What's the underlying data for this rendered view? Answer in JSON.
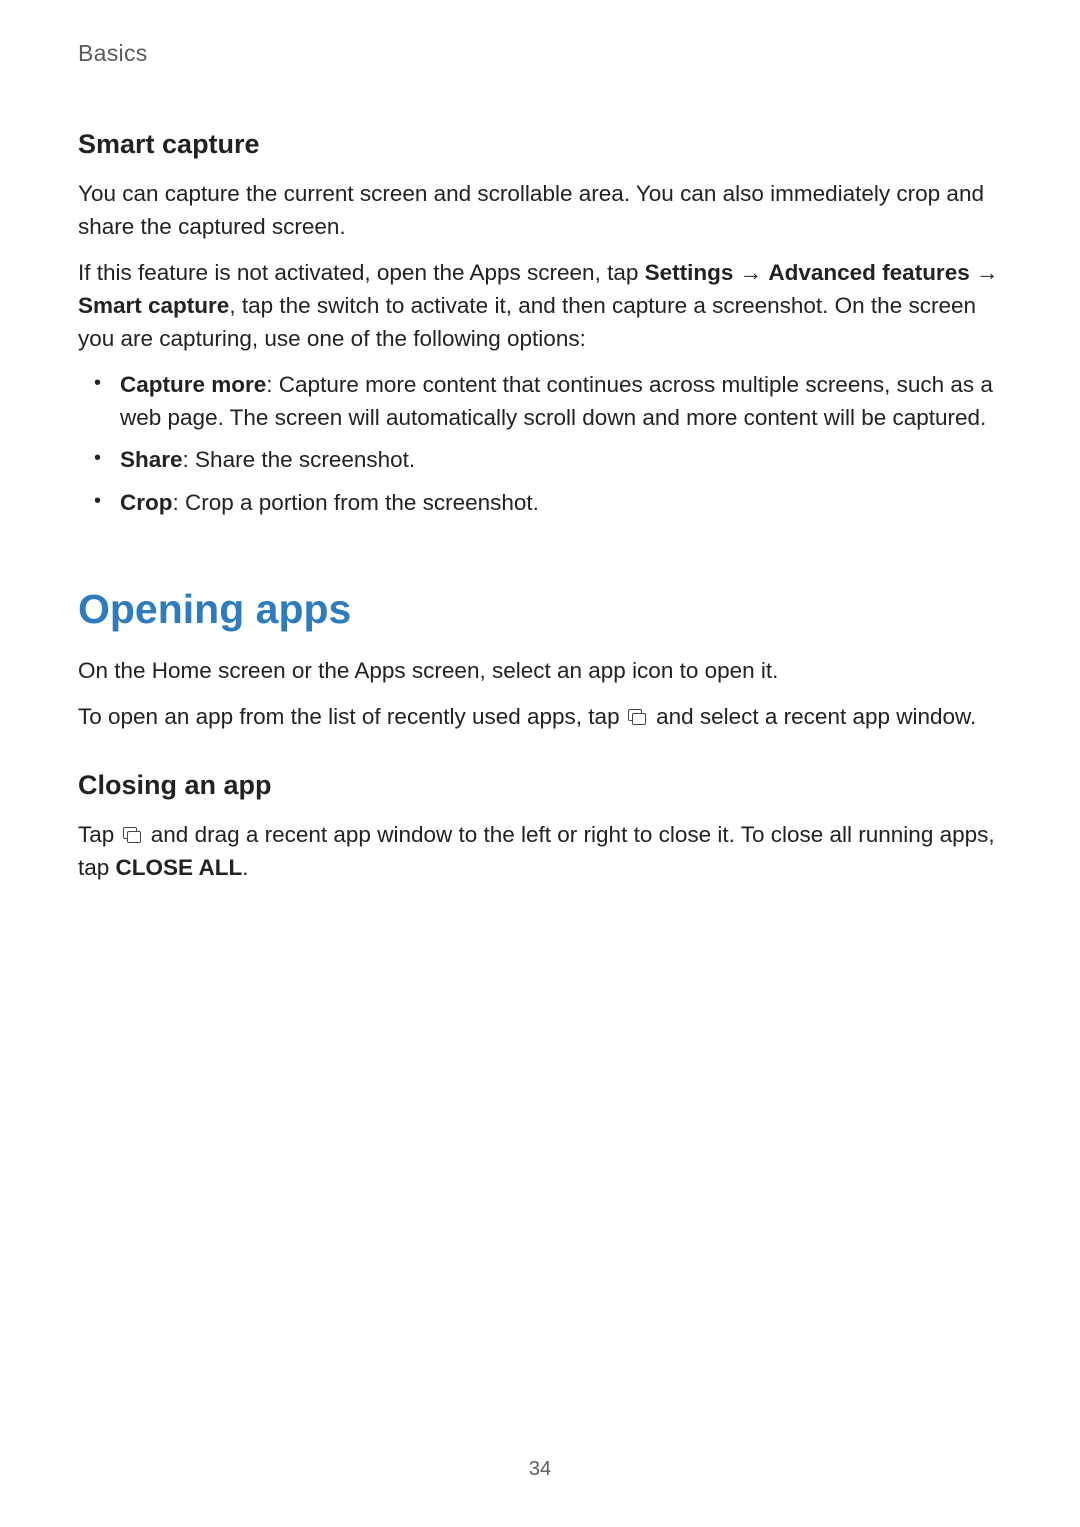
{
  "header": {
    "section": "Basics"
  },
  "smart_capture": {
    "heading": "Smart capture",
    "p1": "You can capture the current screen and scrollable area. You can also immediately crop and share the captured screen.",
    "p2_prefix": "If this feature is not activated, open the Apps screen, tap ",
    "p2_settings": "Settings",
    "p2_arrow1": " → ",
    "p2_adv": "Advanced features",
    "p2_arrow2": " → ",
    "p2_sc": "Smart capture",
    "p2_suffix": ", tap the switch to activate it, and then capture a screenshot. On the screen you are capturing, use one of the following options:",
    "bullets": [
      {
        "term": "Capture more",
        "desc": ": Capture more content that continues across multiple screens, such as a web page. The screen will automatically scroll down and more content will be captured."
      },
      {
        "term": "Share",
        "desc": ": Share the screenshot."
      },
      {
        "term": "Crop",
        "desc": ": Crop a portion from the screenshot."
      }
    ]
  },
  "opening_apps": {
    "heading": "Opening apps",
    "p1": "On the Home screen or the Apps screen, select an app icon to open it.",
    "p2_prefix": "To open an app from the list of recently used apps, tap ",
    "p2_suffix": " and select a recent app window."
  },
  "closing_app": {
    "heading": "Closing an app",
    "p1_prefix": "Tap ",
    "p1_mid": " and drag a recent app window to the left or right to close it. To close all running apps, tap ",
    "p1_closeall": "CLOSE ALL",
    "p1_suffix": "."
  },
  "page_number": "34"
}
